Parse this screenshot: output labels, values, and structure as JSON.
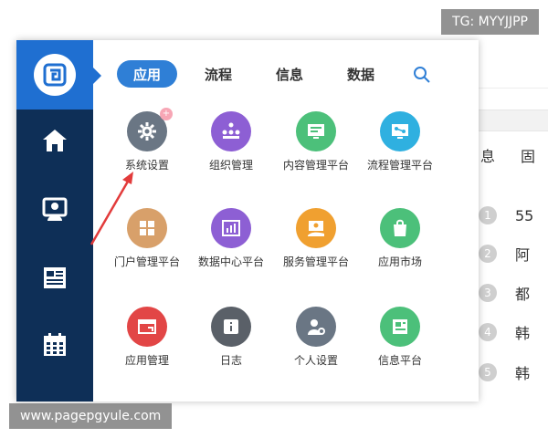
{
  "tabs": [
    {
      "label": "应用",
      "active": true
    },
    {
      "label": "流程",
      "active": false
    },
    {
      "label": "信息",
      "active": false
    },
    {
      "label": "数据",
      "active": false
    }
  ],
  "apps": [
    {
      "label": "系统设置",
      "icon": "gear-icon",
      "color": "#6a7684",
      "badge": "+"
    },
    {
      "label": "组织管理",
      "icon": "org-chart-icon",
      "color": "#8d5fd4"
    },
    {
      "label": "内容管理平台",
      "icon": "content-monitor-icon",
      "color": "#4cc07a"
    },
    {
      "label": "流程管理平台",
      "icon": "workflow-monitor-icon",
      "color": "#2fb0e0"
    },
    {
      "label": "门户管理平台",
      "icon": "portal-grid-icon",
      "color": "#d8a06a"
    },
    {
      "label": "数据中心平台",
      "icon": "bar-chart-icon",
      "color": "#8d5fd4"
    },
    {
      "label": "服务管理平台",
      "icon": "service-hand-icon",
      "color": "#f0a030"
    },
    {
      "label": "应用市场",
      "icon": "shopping-bag-icon",
      "color": "#4cc07a"
    },
    {
      "label": "应用管理",
      "icon": "app-window-icon",
      "color": "#e24646"
    },
    {
      "label": "日志",
      "icon": "log-book-icon",
      "color": "#5a6068"
    },
    {
      "label": "个人设置",
      "icon": "user-settings-icon",
      "color": "#6a7684"
    },
    {
      "label": "信息平台",
      "icon": "info-newspaper-icon",
      "color": "#4cc07a"
    }
  ],
  "background": {
    "col_headers": [
      "息",
      "固"
    ],
    "rows": [
      {
        "num": "1",
        "text": "55"
      },
      {
        "num": "2",
        "text": "阿"
      },
      {
        "num": "3",
        "text": "都"
      },
      {
        "num": "4",
        "text": "韩"
      },
      {
        "num": "5",
        "text": "韩"
      }
    ]
  },
  "watermarks": {
    "top": "TG: MYYJJPP",
    "bottom": "www.pagepgyule.com"
  }
}
